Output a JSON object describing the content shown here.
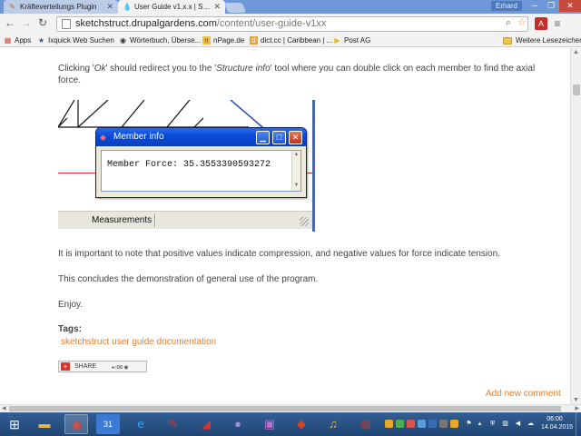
{
  "browser": {
    "tabs": [
      {
        "title": "Kräfteverteilungs Plugin",
        "active": false,
        "favicon": "pencil-icon"
      },
      {
        "title": "User Guide v1.x.x | Sketch",
        "active": true,
        "favicon": "drupal-icon"
      }
    ],
    "user_badge": "Erhard",
    "url": {
      "host": "sketchstruct.drupalgardens.com",
      "path": "/content/user-guide-v1xx"
    },
    "bookmarks": [
      {
        "label": "Apps",
        "icon": "apps-grid-icon"
      },
      {
        "label": "Ixquick Web Suchen",
        "icon": "star-icon"
      },
      {
        "label": "Wörterbuch, Überse...",
        "icon": "dictionary-icon"
      },
      {
        "label": "nPage.de",
        "icon": "npage-icon"
      },
      {
        "label": "dict.cc | Caribbean | ...",
        "icon": "dictcc-icon"
      },
      {
        "label": "Post AG",
        "icon": "post-horn-icon"
      }
    ],
    "other_bookmarks": "Weitere Lesezeichen"
  },
  "page": {
    "intro_parts": [
      "Clicking '",
      "Ok",
      "' should redirect you to the '",
      "Structure info",
      "' tool where you can double click on each member to find the axial force."
    ],
    "figure": {
      "dialog_title": "Member info",
      "dialog_text": "Member Force: 35.3553390593272",
      "status_label": "Measurements"
    },
    "para_compression": "It is important to note that positive values indicate compression, and negative values for force indicate tension.",
    "para_conclusion": "This concludes the demonstration of general use of the program.",
    "para_enjoy": "Enjoy.",
    "tags_heading": "Tags:",
    "tags": "sketchstruct user guide documentation",
    "share_label": "SHARE",
    "add_comment": "Add new comment"
  },
  "taskbar": {
    "apps": [
      {
        "name": "file-explorer-icon",
        "color": "#e8b84a"
      },
      {
        "name": "chrome-icon",
        "color": "#e04a3a",
        "running": true
      },
      {
        "name": "calendar-icon",
        "label": "31",
        "color": "#3b7bd4"
      },
      {
        "name": "internet-explorer-icon",
        "color": "#3aa0e8"
      },
      {
        "name": "pen-tool-icon",
        "color": "#c0392b"
      },
      {
        "name": "acrobat-icon",
        "color": "#d9342b"
      },
      {
        "name": "media-player-icon",
        "color": "#5a4aa0"
      },
      {
        "name": "photo-viewer-icon",
        "color": "#b86fd0"
      },
      {
        "name": "sketchup-icon",
        "color": "#d7412a"
      },
      {
        "name": "headphones-icon",
        "color": "#f0b428"
      },
      {
        "name": "notes-icon",
        "color": "#d8d8d8"
      },
      {
        "name": "recorder-icon",
        "color": "#c0392b"
      }
    ],
    "clock_time": "06:00",
    "clock_date": "14.04.2015"
  }
}
